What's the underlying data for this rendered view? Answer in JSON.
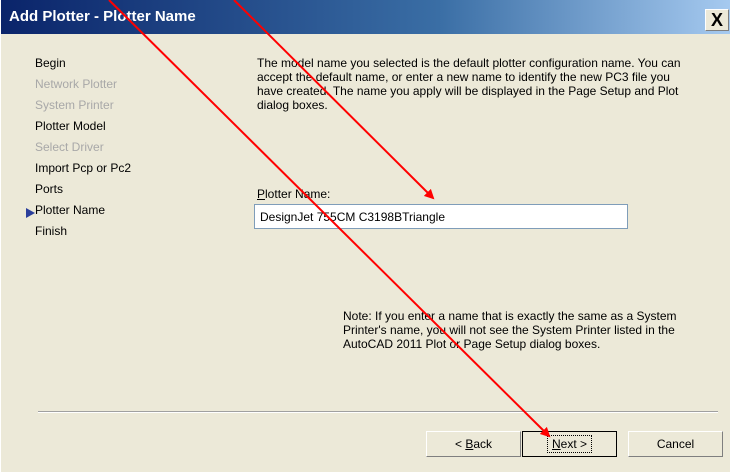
{
  "window": {
    "title": "Add Plotter - Plotter Name",
    "close_symbol": "X"
  },
  "steps": [
    {
      "label": "Begin",
      "enabled": true
    },
    {
      "label": "Network Plotter",
      "enabled": false
    },
    {
      "label": "System Printer",
      "enabled": false
    },
    {
      "label": "Plotter Model",
      "enabled": true
    },
    {
      "label": "Select Driver",
      "enabled": false
    },
    {
      "label": "Import Pcp or Pc2",
      "enabled": true
    },
    {
      "label": "Ports",
      "enabled": true
    },
    {
      "label": "Plotter Name",
      "enabled": true,
      "current": true
    },
    {
      "label": "Finish",
      "enabled": true
    }
  ],
  "content": {
    "description": "The model name you selected is the default plotter configuration name. You can accept the default name, or enter a new name to identify the new PC3 file you have created. The name you apply will be displayed in the Page Setup and Plot dialog boxes.",
    "field_label_first": "P",
    "field_label_rest": "lotter Name:",
    "plotter_name_value": "DesignJet 755CM C3198BTriangle",
    "note": "Note: If you enter a name that is exactly the same as a System Printer's name, you will not see the System Printer listed in the AutoCAD 2011 Plot or Page Setup dialog boxes."
  },
  "buttons": {
    "back_prefix": "< ",
    "back_mnemonic": "B",
    "back_rest": "ack",
    "next_mnemonic": "N",
    "next_rest": "ext >",
    "cancel": "Cancel"
  },
  "colors": {
    "annotation_arrow": "#ff0000",
    "titlebar_start": "#0a246a",
    "dialog_bg": "#ece9d8"
  }
}
